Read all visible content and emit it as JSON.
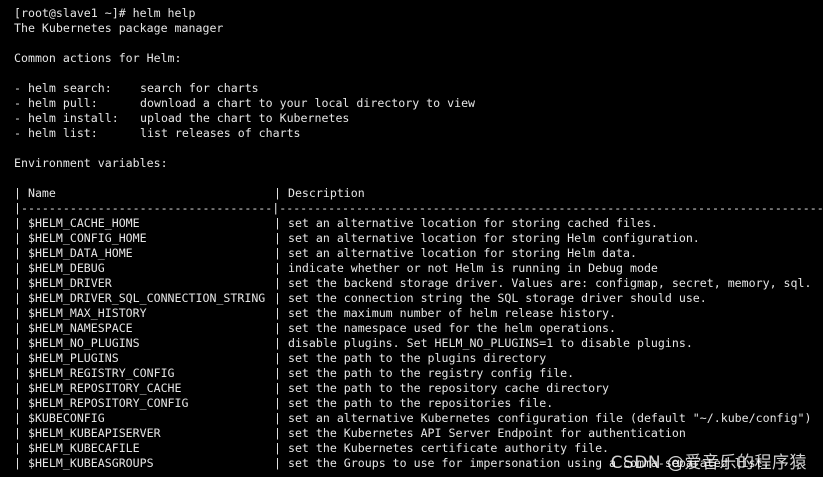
{
  "terminal": {
    "prompt": "[root@slave1 ~]# helm help",
    "subtitle": "The Kubernetes package manager",
    "common_heading": "Common actions for Helm:",
    "commands": [
      {
        "name": "- helm search:",
        "desc": "search for charts"
      },
      {
        "name": "- helm pull:",
        "desc": "download a chart to your local directory to view"
      },
      {
        "name": "- helm install:",
        "desc": "upload the chart to Kubernetes"
      },
      {
        "name": "- helm list:",
        "desc": "list releases of charts"
      }
    ],
    "env_heading": "Environment variables:",
    "table_header": {
      "name": "| Name",
      "desc": "| Description"
    },
    "table_separator": "|------------------------------------|-----------------------------------------------------------------------------------",
    "rows": [
      {
        "name": "| $HELM_CACHE_HOME",
        "desc": "| set an alternative location for storing cached files."
      },
      {
        "name": "| $HELM_CONFIG_HOME",
        "desc": "| set an alternative location for storing Helm configuration."
      },
      {
        "name": "| $HELM_DATA_HOME",
        "desc": "| set an alternative location for storing Helm data."
      },
      {
        "name": "| $HELM_DEBUG",
        "desc": "| indicate whether or not Helm is running in Debug mode"
      },
      {
        "name": "| $HELM_DRIVER",
        "desc": "| set the backend storage driver. Values are: configmap, secret, memory, sql."
      },
      {
        "name": "| $HELM_DRIVER_SQL_CONNECTION_STRING",
        "desc": "| set the connection string the SQL storage driver should use."
      },
      {
        "name": "| $HELM_MAX_HISTORY",
        "desc": "| set the maximum number of helm release history."
      },
      {
        "name": "| $HELM_NAMESPACE",
        "desc": "| set the namespace used for the helm operations."
      },
      {
        "name": "| $HELM_NO_PLUGINS",
        "desc": "| disable plugins. Set HELM_NO_PLUGINS=1 to disable plugins."
      },
      {
        "name": "| $HELM_PLUGINS",
        "desc": "| set the path to the plugins directory"
      },
      {
        "name": "| $HELM_REGISTRY_CONFIG",
        "desc": "| set the path to the registry config file."
      },
      {
        "name": "| $HELM_REPOSITORY_CACHE",
        "desc": "| set the path to the repository cache directory"
      },
      {
        "name": "| $HELM_REPOSITORY_CONFIG",
        "desc": "| set the path to the repositories file."
      },
      {
        "name": "| $KUBECONFIG",
        "desc": "| set an alternative Kubernetes configuration file (default \"~/.kube/config\")"
      },
      {
        "name": "| $HELM_KUBEAPISERVER",
        "desc": "| set the Kubernetes API Server Endpoint for authentication"
      },
      {
        "name": "| $HELM_KUBECAFILE",
        "desc": "| set the Kubernetes certificate authority file."
      },
      {
        "name": "| $HELM_KUBEASGROUPS",
        "desc": "| set the Groups to use for impersonation using a comma-separated list."
      }
    ]
  },
  "watermark": "CSDN @爱音乐的程序猿"
}
